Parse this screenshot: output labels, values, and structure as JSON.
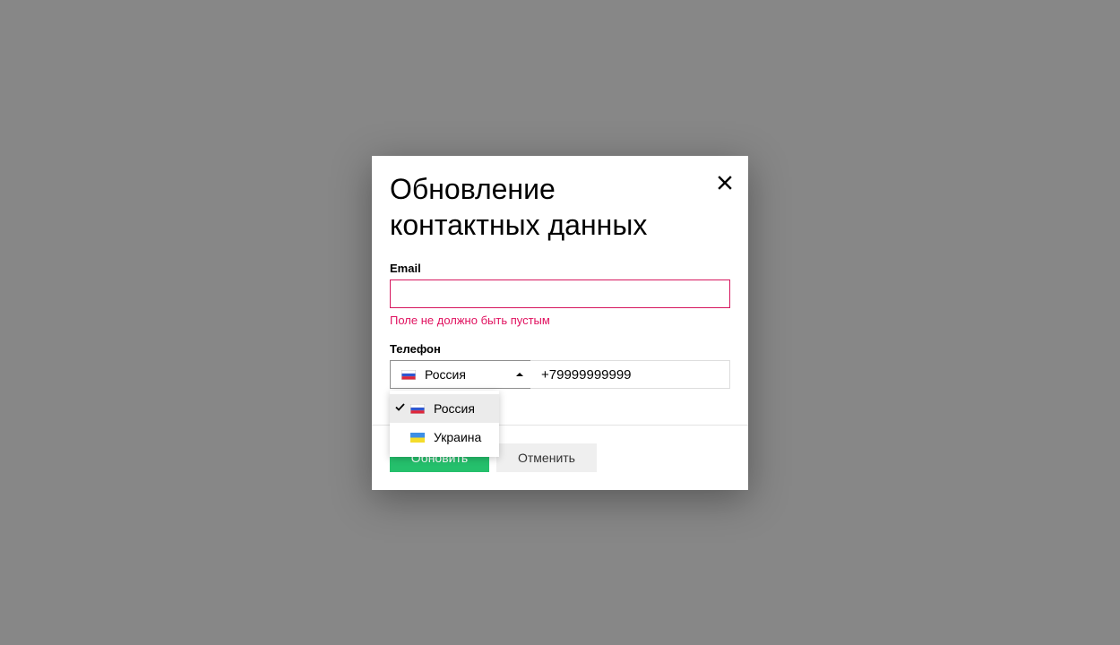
{
  "modal": {
    "title": "Обновление контактных данных",
    "email": {
      "label": "Email",
      "value": "",
      "error": "Поле не должно быть пустым"
    },
    "phone": {
      "label": "Телефон",
      "selected_country": "Россия",
      "number": "+79999999999"
    },
    "countries": [
      {
        "name": "Россия",
        "flag": "flag-russia-icon",
        "selected": true
      },
      {
        "name": "Украина",
        "flag": "flag-ukraine-icon",
        "selected": false
      }
    ],
    "buttons": {
      "update": "Обновить",
      "cancel": "Отменить"
    }
  },
  "colors": {
    "overlay": "#878787",
    "error": "#e0115f",
    "primary_button": "#25c06c",
    "secondary_button": "#efefef"
  }
}
